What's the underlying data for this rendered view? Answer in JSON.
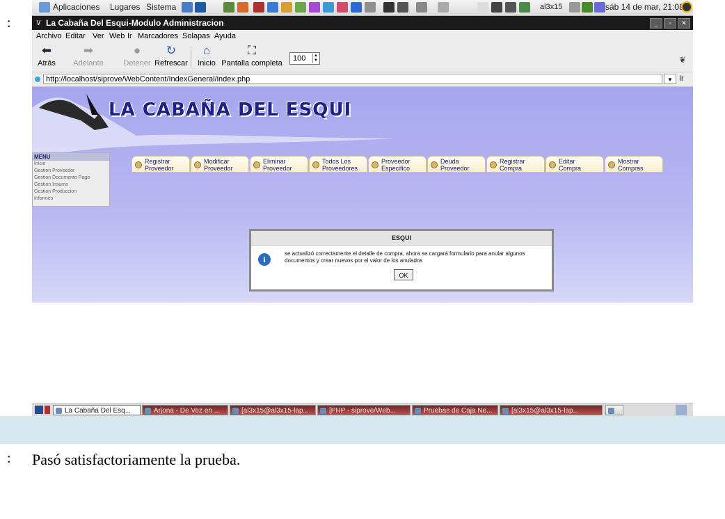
{
  "document": {
    "colon_top": ":",
    "colon_bottom": ":",
    "caption": "Pasó satisfactoriamente la prueba."
  },
  "gnome_panel": {
    "menus": [
      "Aplicaciones",
      "Lugares",
      "Sistema"
    ],
    "user": "al3x15",
    "clock": "sáb 14 de mar, 21:08"
  },
  "window": {
    "title": "La Cabaña Del Esqui-Modulo Administracion"
  },
  "browser": {
    "menubar": [
      "Archivo",
      "Editar",
      "Ver",
      "Web",
      "Ir",
      "Marcadores",
      "Solapas",
      "Ayuda"
    ],
    "toolbar": {
      "back": "Atrás",
      "forward": "Adelante",
      "stop": "Detener",
      "reload": "Refrescar",
      "home": "Inicio",
      "fullscreen": "Pantalla completa",
      "zoom": "100"
    },
    "address": "http://localhost/siprove/WebContent/IndexGeneral/index.php",
    "go": "Ir"
  },
  "page": {
    "logo": "LA CABAÑA DEL ESQUI",
    "menu": {
      "header": "MENU",
      "items": [
        "Inicio",
        "Gestion Proveedor",
        "Gestion Documento Pago",
        "Gestion Insumo",
        "Gestion Produccion",
        "Informes"
      ]
    },
    "nav_buttons": [
      "Registrar\nProveedor",
      "Modificar\nProveedor",
      "Eliminar\nProveedor",
      "Todos Los\nProveedores",
      "Proveedor\nEspecifico",
      "Deuda\nProveedor",
      "Registrar\nCompra",
      "Editar\nCompra",
      "Mostrar\nCompras"
    ]
  },
  "dialog": {
    "title": "ESQUI",
    "message": "se actualizó correctamente el detalle de compra, ahora se cargará formulario para anular algunos documentos y crear nuevos por el valor de los anulados",
    "ok": "OK"
  },
  "taskbar": {
    "tasks": [
      "La Cabaña Del Esq...",
      "Arjona - De Vez en ...",
      "[al3x15@al3x15-lap...",
      "[PHP - siprove/Web...",
      "Pruebas de Caja Ne...",
      "[al3x15@al3x15-lap..."
    ]
  }
}
